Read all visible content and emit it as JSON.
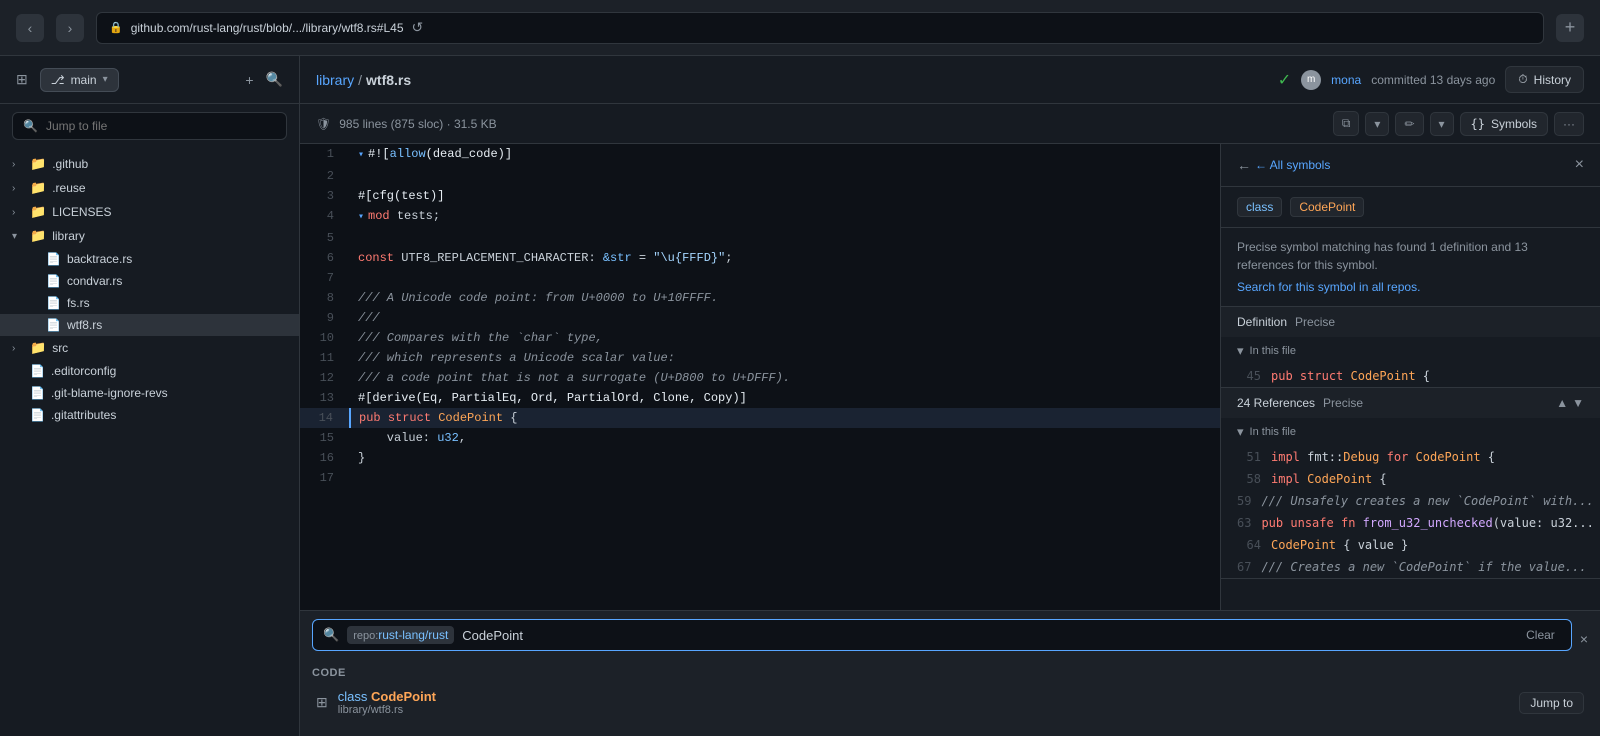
{
  "browser": {
    "url": "github.com/rust-lang/rust/blob/.../library/wtf8.rs#L45",
    "back_label": "‹",
    "forward_label": "›",
    "lock_icon": "🔒",
    "refresh_icon": "↺",
    "new_tab_icon": "+"
  },
  "sidebar": {
    "branch": "main",
    "branch_icon": "⎇",
    "chevron": "▾",
    "add_icon": "+",
    "search_icon": "🔍",
    "toggle_icon": "⊞",
    "search_placeholder": "Jump to file",
    "tree": [
      {
        "name": ".github",
        "type": "folder",
        "indent": 0,
        "collapsed": true
      },
      {
        "name": ".reuse",
        "type": "folder",
        "indent": 0,
        "collapsed": true
      },
      {
        "name": "LICENSES",
        "type": "folder",
        "indent": 0,
        "collapsed": true
      },
      {
        "name": "library",
        "type": "folder",
        "indent": 0,
        "collapsed": false
      },
      {
        "name": "backtrace.rs",
        "type": "file",
        "indent": 1
      },
      {
        "name": "condvar.rs",
        "type": "file",
        "indent": 1
      },
      {
        "name": "fs.rs",
        "type": "file",
        "indent": 1
      },
      {
        "name": "wtf8.rs",
        "type": "file",
        "indent": 1,
        "active": true
      },
      {
        "name": "src",
        "type": "folder",
        "indent": 0,
        "collapsed": true
      },
      {
        "name": ".editorconfig",
        "type": "file",
        "indent": 0
      },
      {
        "name": ".git-blame-ignore-revs",
        "type": "file",
        "indent": 0
      },
      {
        "name": ".gitattributes",
        "type": "file",
        "indent": 0
      }
    ]
  },
  "file_header": {
    "library_link": "library",
    "sep": "/",
    "filename": "wtf8.rs",
    "check_icon": "✓",
    "avatar_initials": "m",
    "author": "mona",
    "commit_text": "committed 13 days ago",
    "history_icon": "⏱",
    "history_label": "History"
  },
  "file_info": {
    "shield_icon": "🛡",
    "info": "985 lines (875 sloc) · 31.5 KB",
    "copy_icon": "⧉",
    "edit_icon": "✏",
    "more_icon": "···",
    "symbols_icon": "{}",
    "symbols_label": "Symbols",
    "more_icon2": "⋯"
  },
  "code": {
    "lines": [
      {
        "num": 1,
        "content": "#![allow(dead_code)]",
        "collapse": true
      },
      {
        "num": 2,
        "content": ""
      },
      {
        "num": 3,
        "content": "#[cfg(test)]"
      },
      {
        "num": 4,
        "content": "mod tests;",
        "collapse": true
      },
      {
        "num": 5,
        "content": ""
      },
      {
        "num": 6,
        "content": "const UTF8_REPLACEMENT_CHARACTER: &str = \"\\u{FFFD}\";"
      },
      {
        "num": 7,
        "content": ""
      },
      {
        "num": 8,
        "content": "/// A Unicode code point: from U+0000 to U+10FFFF."
      },
      {
        "num": 9,
        "content": "///"
      },
      {
        "num": 10,
        "content": "/// Compares with the `char` type,"
      },
      {
        "num": 11,
        "content": "/// which represents a Unicode scalar value:"
      },
      {
        "num": 12,
        "content": "/// a code point that is not a surrogate (U+D800 to U+DFFF)."
      },
      {
        "num": 13,
        "content": "#[derive(Eq, PartialEq, Ord, PartialOrd, Clone, Copy)]"
      },
      {
        "num": 14,
        "content": "pub struct CodePoint {",
        "highlighted": true
      },
      {
        "num": 15,
        "content": "    value: u32,"
      },
      {
        "num": 16,
        "content": "}"
      },
      {
        "num": 17,
        "content": ""
      }
    ]
  },
  "symbols_panel": {
    "back_label": "← All symbols",
    "close_label": "×",
    "class_badge": "class",
    "symbol_name": "CodePoint",
    "description": "Precise symbol matching has found 1 definition and 13 references for this symbol.",
    "search_link": "Search for this symbol in all repos.",
    "definition_label": "Definition",
    "definition_badge": "Precise",
    "def_in_file": "In this file",
    "def_collapse_icon": "▾",
    "def_line": 45,
    "def_code": "pub struct CodePoint {",
    "references_label": "24 References",
    "references_badge": "Precise",
    "refs_expand_up": "▲",
    "refs_expand_down": "▼",
    "refs_in_file": "In this file",
    "refs": [
      {
        "line": 51,
        "code": "impl fmt::Debug for CodePoint {"
      },
      {
        "line": 58,
        "code": "impl CodePoint {"
      },
      {
        "line": 59,
        "code": "/// Unsafely creates a new `CodePoint` with..."
      },
      {
        "line": 63,
        "code": "pub unsafe fn from_u32_unchecked(value: u32..."
      },
      {
        "line": 64,
        "code": "CodePoint { value }"
      },
      {
        "line": 67,
        "code": "/// Creates a new `CodePoint` if the value..."
      }
    ]
  },
  "search_overlay": {
    "search_icon": "🔍",
    "repo_prefix": "repo:",
    "repo_name": "rust-lang/rust",
    "query": "CodePoint",
    "clear_label": "Clear",
    "close_label": "×",
    "code_section_label": "Code",
    "result_icon": "⊞",
    "result_class": "class",
    "result_name": "CodePoint",
    "result_path": "library/wtf8.rs",
    "jump_to_label": "Jump to"
  }
}
